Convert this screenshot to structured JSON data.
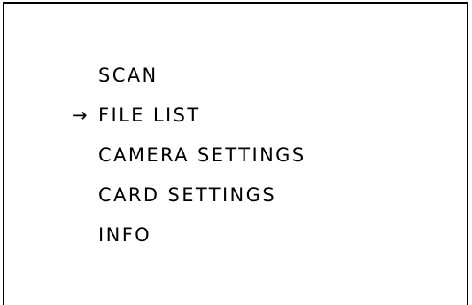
{
  "menu": {
    "cursor_glyph": "→",
    "selected_index": 1,
    "items": [
      {
        "label": "SCAN"
      },
      {
        "label": "FILE LIST"
      },
      {
        "label": "CAMERA SETTINGS"
      },
      {
        "label": "CARD SETTINGS"
      },
      {
        "label": "INFO"
      }
    ]
  }
}
